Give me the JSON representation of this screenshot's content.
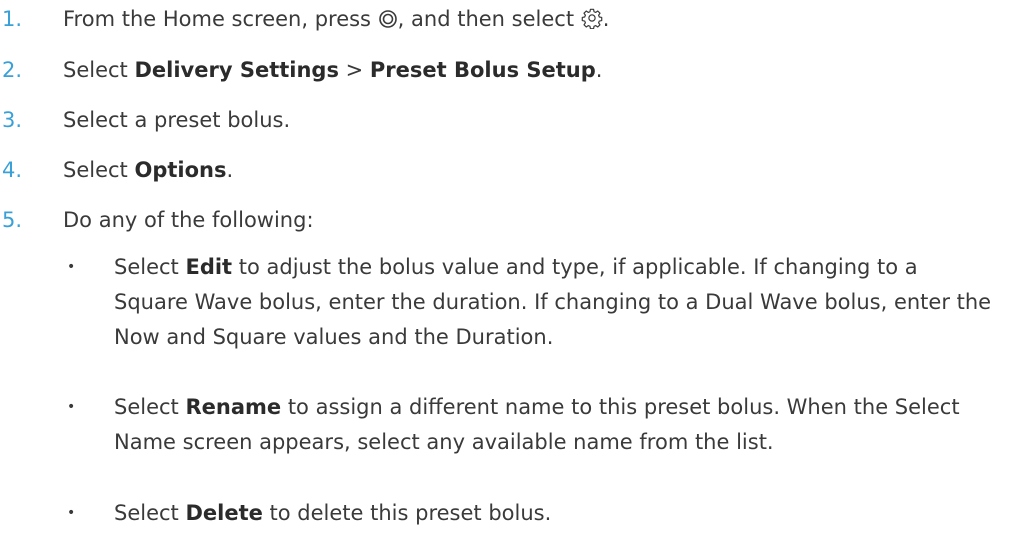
{
  "steps": [
    {
      "num": "1.",
      "t1": "From the Home screen, press ",
      "t2": ", and then select ",
      "t3": ".",
      "icons": [
        "select-button-icon",
        "gear-icon"
      ]
    },
    {
      "num": "2.",
      "t1": "Select ",
      "b1": "Delivery Settings",
      "t2": " > ",
      "b2": "Preset Bolus Setup",
      "t3": "."
    },
    {
      "num": "3.",
      "t1": "Select a preset bolus."
    },
    {
      "num": "4.",
      "t1": "Select ",
      "b1": "Options",
      "t2": "."
    },
    {
      "num": "5.",
      "t1": "Do any of the following:"
    }
  ],
  "bullets": [
    {
      "dot": "•",
      "pre": "Select ",
      "bold": "Edit",
      "post": " to adjust the bolus value and type, if applicable. If changing to a Square Wave bolus, enter the duration. If changing to a Dual Wave bolus, enter the Now and Square values and the Duration."
    },
    {
      "dot": "•",
      "pre": "Select ",
      "bold": "Rename",
      "post": " to assign a different name to this preset bolus. When the Select Name screen appears, select any available name from the list."
    },
    {
      "dot": "•",
      "pre": "Select ",
      "bold": "Delete",
      "post": " to delete this preset bolus."
    }
  ]
}
